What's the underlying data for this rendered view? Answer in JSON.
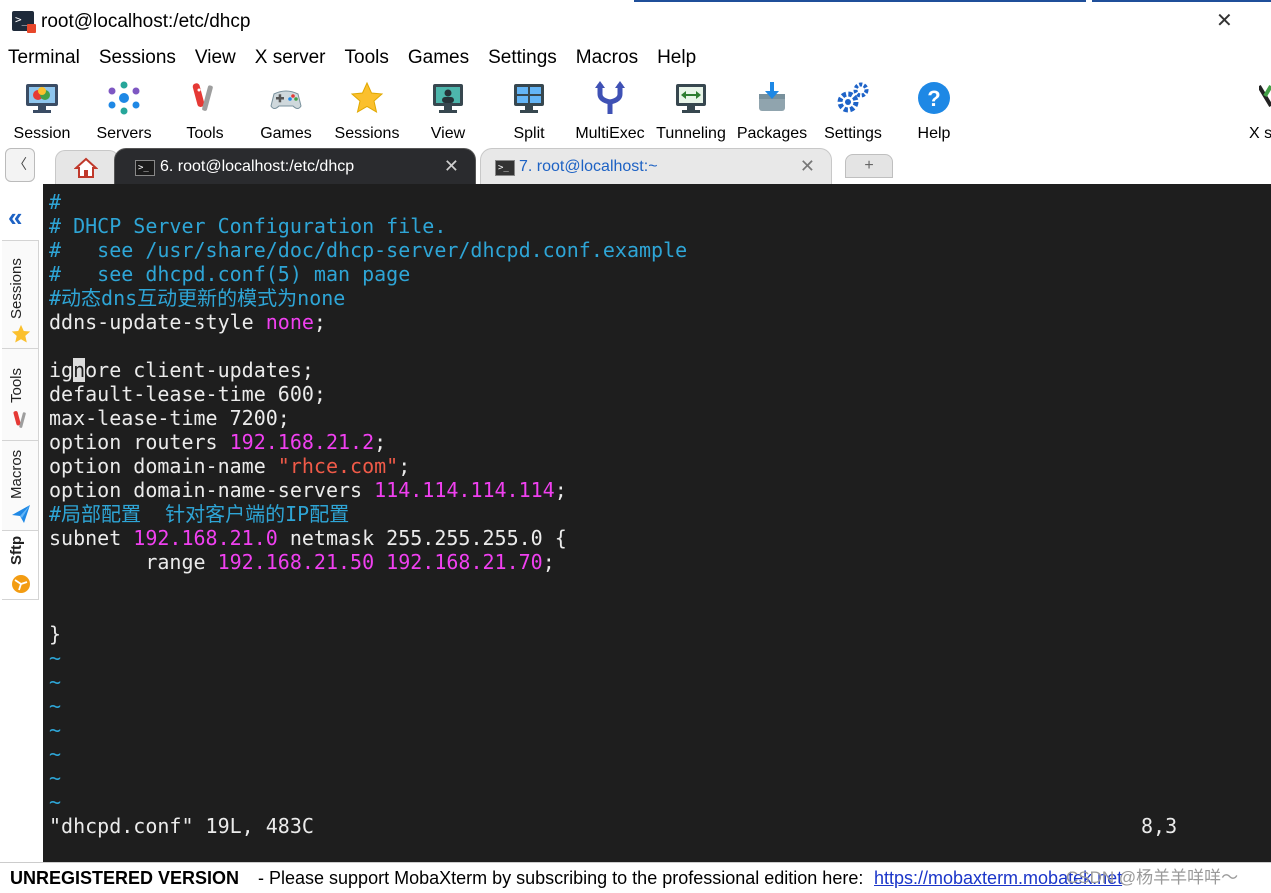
{
  "window": {
    "title": "root@localhost:/etc/dhcp",
    "close_glyph": "✕",
    "icon": "terminal-app-icon"
  },
  "menubar": [
    "Terminal",
    "Sessions",
    "View",
    "X server",
    "Tools",
    "Games",
    "Settings",
    "Macros",
    "Help"
  ],
  "toolbar": {
    "session": "Session",
    "servers": "Servers",
    "tools": "Tools",
    "games": "Games",
    "sessions": "Sessions",
    "view": "View",
    "split": "Split",
    "multiexec": "MultiExec",
    "tunneling": "Tunneling",
    "packages": "Packages",
    "settings": "Settings",
    "help": "Help",
    "xserver_partial": "X s"
  },
  "tabs": {
    "active_label": "6. root@localhost:/etc/dhcp",
    "inactive_label": "7. root@localhost:~",
    "close_glyph": "✕",
    "new_tab_glyph": "+",
    "back_glyph": "〈"
  },
  "sidebar": {
    "collapse_glyph": "«",
    "sessions": "Sessions",
    "tools": "Tools",
    "macros": "Macros",
    "sftp": "Sftp"
  },
  "terminal": {
    "l1": "#",
    "l2": "# DHCP Server Configuration file.",
    "l3": "#   see /usr/share/doc/dhcp-server/dhcpd.conf.example",
    "l4": "#   see dhcpd.conf(5) man page",
    "l5": "#动态dns互动更新的模式为none",
    "l6a": "ddns-update-style ",
    "l6b": "none",
    "l6c": ";",
    "l8a": "ig",
    "l8b": "n",
    "l8c": "ore client-updates;",
    "l9a": "default-lease-time ",
    "l9b": "600",
    "l9c": ";",
    "l10a": "max-lease-time ",
    "l10b": "7200",
    "l10c": ";",
    "l11a": "option routers ",
    "l11b": "192.168.21.2",
    "l11c": ";",
    "l12a": "option domain-name ",
    "l12b": "\"rhce.com\"",
    "l12c": ";",
    "l13a": "option domain-name-servers ",
    "l13b": "114.114.114.114",
    "l13c": ";",
    "l14": "#局部配置  针对客户端的IP配置",
    "l15a": "subnet ",
    "l15b": "192.168.21.0",
    "l15c": " netmask ",
    "l15d": "255.255.255.0",
    "l15e": " {",
    "l16a": "        range ",
    "l16b": "192.168.21.50",
    "l16c": " ",
    "l16d": "192.168.21.70",
    "l16e": ";",
    "l19": "}",
    "tilde": "~",
    "status": "\"dhcpd.conf\" 19L, 483C",
    "position": "8,3"
  },
  "statusbar": {
    "unregistered": "UNREGISTERED VERSION",
    "message": "-  Please support MobaXterm by subscribing to the professional edition here:",
    "link": "https://mobaxterm.mobatek.net",
    "watermark": "CSDN @杨羊羊咩咩～"
  },
  "colors": {
    "terminal_bg": "#1e1e1e",
    "comment": "#2ea5d6",
    "number": "#f040f0",
    "string": "#f05a48",
    "link": "#1a35c9"
  }
}
